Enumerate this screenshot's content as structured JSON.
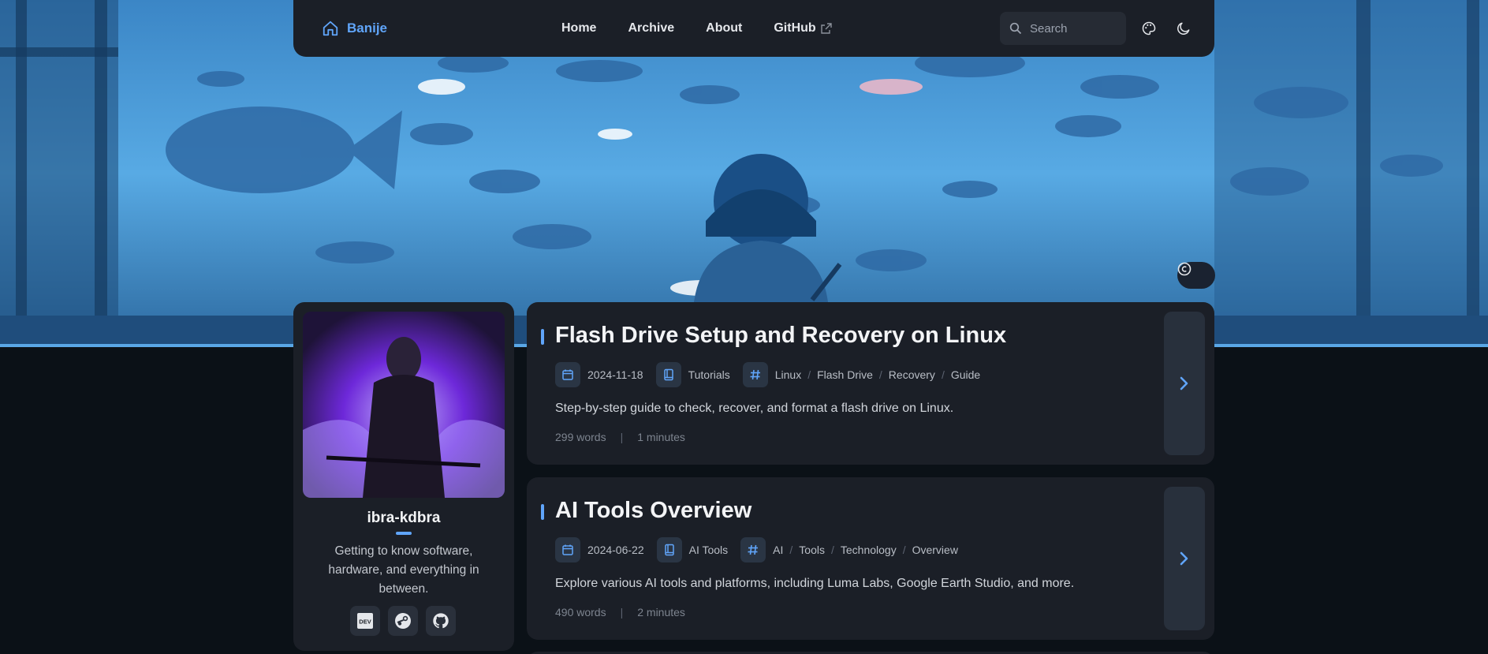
{
  "navbar": {
    "brand": "Banije",
    "links": [
      {
        "label": "Home"
      },
      {
        "label": "Archive"
      },
      {
        "label": "About"
      },
      {
        "label": "GitHub",
        "external": true
      }
    ],
    "search_placeholder": "Search"
  },
  "profile": {
    "name": "ibra-kdbra",
    "bio": "Getting to know software, hardware, and everything in between.",
    "socials": [
      {
        "icon": "dev-icon",
        "label": "DEV"
      },
      {
        "icon": "steam-icon"
      },
      {
        "icon": "github-icon"
      }
    ]
  },
  "posts": [
    {
      "title": "Flash Drive Setup and Recovery on Linux",
      "date": "2024-11-18",
      "category": "Tutorials",
      "tags": [
        "Linux",
        "Flash Drive",
        "Recovery",
        "Guide"
      ],
      "description": "Step-by-step guide to check, recover, and format a flash drive on Linux.",
      "words": "299 words",
      "read_time": "1 minutes"
    },
    {
      "title": "AI Tools Overview",
      "date": "2024-06-22",
      "category": "AI Tools",
      "tags": [
        "AI",
        "Tools",
        "Technology",
        "Overview"
      ],
      "description": "Explore various AI tools and platforms, including Luma Labs, Google Earth Studio, and more.",
      "words": "490 words",
      "read_time": "2 minutes"
    }
  ],
  "colors": {
    "accent": "#60a5fa",
    "card": "#1b1f27",
    "page": "#0b1117"
  }
}
